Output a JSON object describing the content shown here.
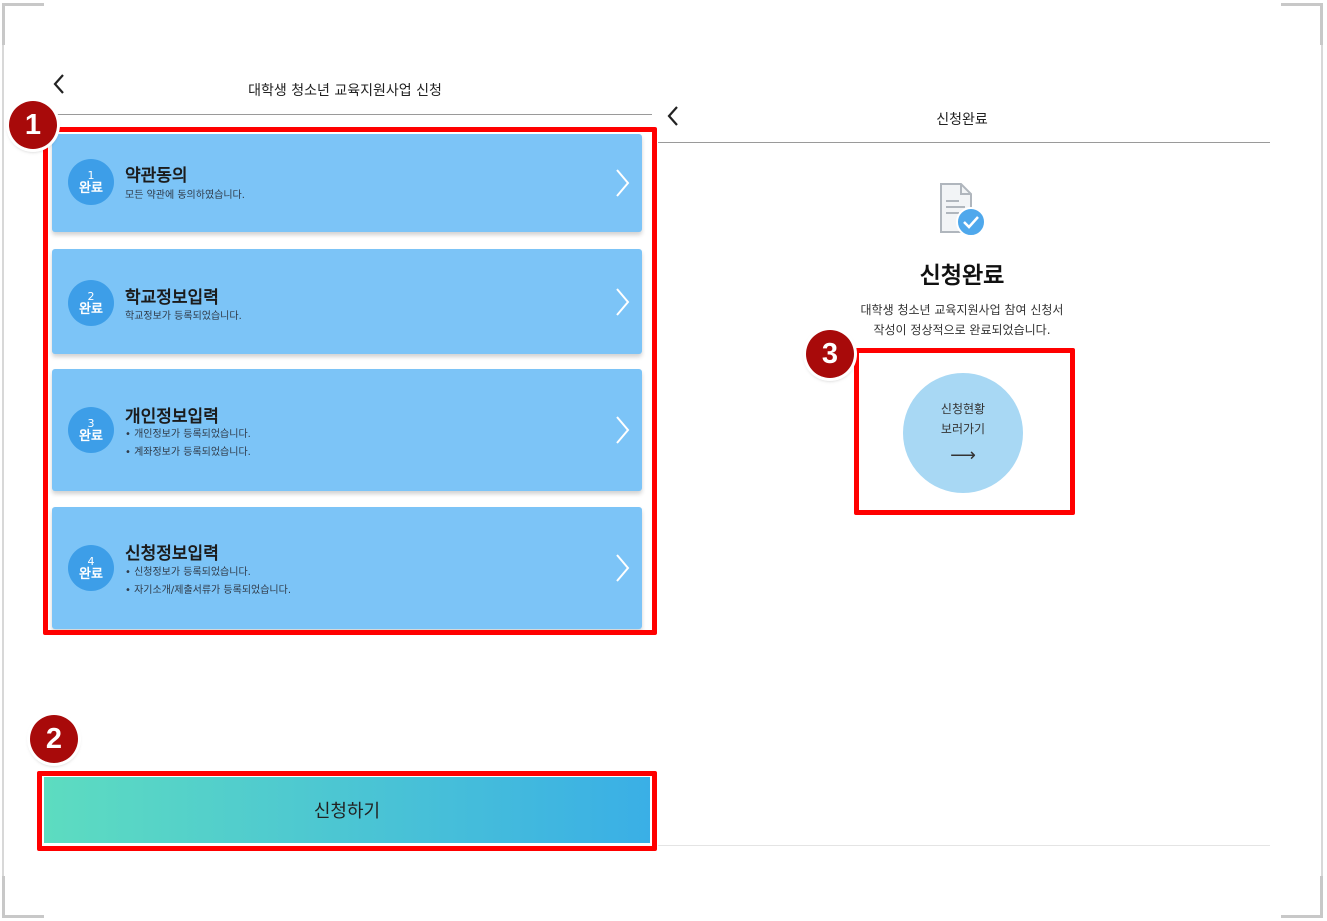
{
  "left_panel": {
    "title": "대학생 청소년 교육지원사업 신청",
    "steps": [
      {
        "num": "1",
        "status": "완료",
        "title": "약관동의",
        "desc": [
          "모든 약관에 동의하였습니다."
        ]
      },
      {
        "num": "2",
        "status": "완료",
        "title": "학교정보입력",
        "desc": [
          "학교정보가 등록되었습니다."
        ]
      },
      {
        "num": "3",
        "status": "완료",
        "title": "개인정보입력",
        "desc": [
          "• 개인정보가 등록되었습니다.",
          "• 계좌정보가 등록되었습니다."
        ]
      },
      {
        "num": "4",
        "status": "완료",
        "title": "신청정보입력",
        "desc": [
          "• 신청정보가 등록되었습니다.",
          "• 자기소개/제출서류가 등록되었습니다."
        ]
      }
    ],
    "apply_button": "신청하기"
  },
  "right_panel": {
    "title": "신청완료",
    "heading": "신청완료",
    "message": [
      "대학생 청소년 교육지원사업 참여 신청서",
      "작성이 정상적으로 완료되었습니다."
    ],
    "status_button": [
      "신청현황",
      "보러가기"
    ],
    "status_arrow": "⟶"
  },
  "markers": [
    "1",
    "2",
    "3"
  ],
  "colors": {
    "card": "#7cc4f7",
    "badge": "#3d9ee8",
    "highlight": "#ff0000",
    "marker": "#a80a0a",
    "button_gradient": [
      "#5ddcc0",
      "#3aafe6"
    ],
    "status_circle": "#a8d8f4"
  },
  "icons": [
    "back-chevron-icon",
    "chevron-right-icon",
    "document-check-icon"
  ]
}
